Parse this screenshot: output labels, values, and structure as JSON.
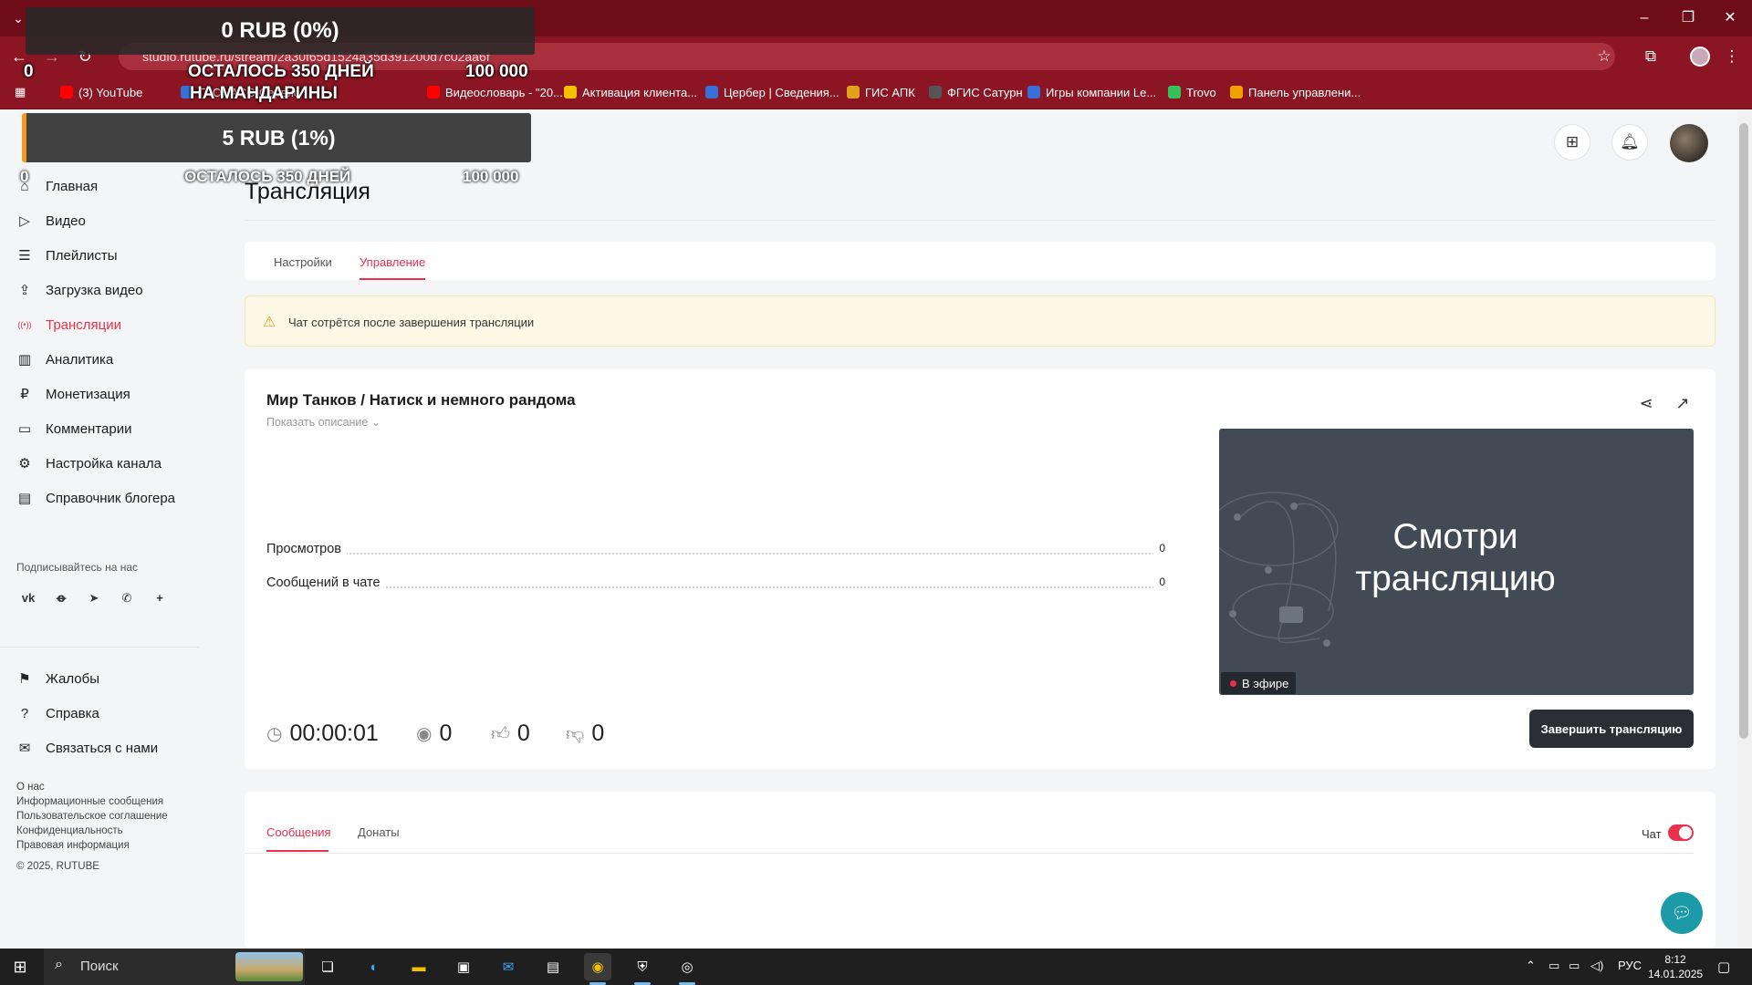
{
  "browser": {
    "url": "studio.rutube.ru/stream/2a30f65d1524a35d391200d7c02aa6f",
    "bookmarks": [
      {
        "label": "(3) YouTube",
        "color": "#ff0000"
      },
      {
        "label": "ГЛОНАСС-Сервис",
        "color": "#3a6fd8"
      },
      {
        "label": "Видеословарь - \"20...",
        "color": "#ff0000"
      },
      {
        "label": "Активация клиента...",
        "color": "#f2c200"
      },
      {
        "label": "Цербер | Сведения...",
        "color": "#3a6fd8"
      },
      {
        "label": "ГИС АПК",
        "color": "#e0a21a"
      },
      {
        "label": "ФГИС Сатурн",
        "color": "#555555"
      },
      {
        "label": "Игры компании Le...",
        "color": "#3a6fd8"
      },
      {
        "label": "Trovo",
        "color": "#36c25b"
      },
      {
        "label": "Панель управлени...",
        "color": "#f2a200"
      }
    ]
  },
  "overlay": {
    "amount_top": "0 RUB (0%)",
    "left_zero_top": "0",
    "days_left_top": "ОСТАЛОСЬ 350 ДНЕЙ",
    "goal_top": "100 000",
    "goal_name": "НА МАНДАРИНЫ",
    "amount_bottom": "5 RUB (1%)",
    "left_zero_bottom": "0",
    "days_left_bottom": "ОСТАЛОСЬ 350 ДНЕЙ",
    "goal_bottom": "100 000"
  },
  "sidebar": {
    "items": [
      {
        "label": "Главная",
        "icon": "home-icon"
      },
      {
        "label": "Видео",
        "icon": "video-icon"
      },
      {
        "label": "Плейлисты",
        "icon": "playlist-icon"
      },
      {
        "label": "Загрузка видео",
        "icon": "upload-icon"
      },
      {
        "label": "Трансляции",
        "icon": "broadcast-icon",
        "active": true
      },
      {
        "label": "Аналитика",
        "icon": "analytics-icon"
      },
      {
        "label": "Монетизация",
        "icon": "monetization-icon"
      },
      {
        "label": "Комментарии",
        "icon": "comments-icon"
      },
      {
        "label": "Настройка канала",
        "icon": "settings-icon"
      },
      {
        "label": "Справочник блогера",
        "icon": "guide-icon"
      }
    ],
    "follow_label": "Подписывайтесь на нас",
    "social": [
      "vk-icon",
      "ok-icon",
      "telegram-icon",
      "viber-icon",
      "plus-icon"
    ],
    "bottom_items": [
      {
        "label": "Жалобы",
        "icon": "flag-icon"
      },
      {
        "label": "Справка",
        "icon": "help-icon"
      },
      {
        "label": "Связаться с нами",
        "icon": "mail-icon"
      }
    ],
    "footer_links": [
      "О нас",
      "Информационные сообщения",
      "Пользовательское соглашение",
      "Конфиденциальность",
      "Правовая информация"
    ],
    "copyright": "© 2025, RUTUBE"
  },
  "main": {
    "page_title": "Трансляция",
    "tabs": [
      {
        "label": "Настройки",
        "active": false
      },
      {
        "label": "Управление",
        "active": true
      }
    ],
    "warning": "Чат сотрётся после завершения трансляции",
    "stream": {
      "title": "Мир Танков / Натиск и немного рандома",
      "show_description": "Показать описание",
      "stats": [
        {
          "label": "Просмотров",
          "value": "0"
        },
        {
          "label": "Сообщений в чате",
          "value": "0"
        }
      ],
      "timer": "00:00:01",
      "viewers": "0",
      "likes": "0",
      "dislikes": "0",
      "preview_text": "Смотри трансляцию",
      "live_badge": "В эфире",
      "end_button": "Завершить трансляцию"
    },
    "chat_tabs": [
      {
        "label": "Сообщения",
        "active": true
      },
      {
        "label": "Донаты",
        "active": false
      }
    ],
    "chat_toggle_label": "Чат",
    "chat_enabled": true
  },
  "taskbar": {
    "search_placeholder": "Поиск",
    "language": "РУС",
    "time": "8:12",
    "date": "14.01.2025"
  },
  "colors": {
    "accent": "#e8324b",
    "browser_frame": "#8b1523",
    "preview_bg": "#424b55"
  }
}
